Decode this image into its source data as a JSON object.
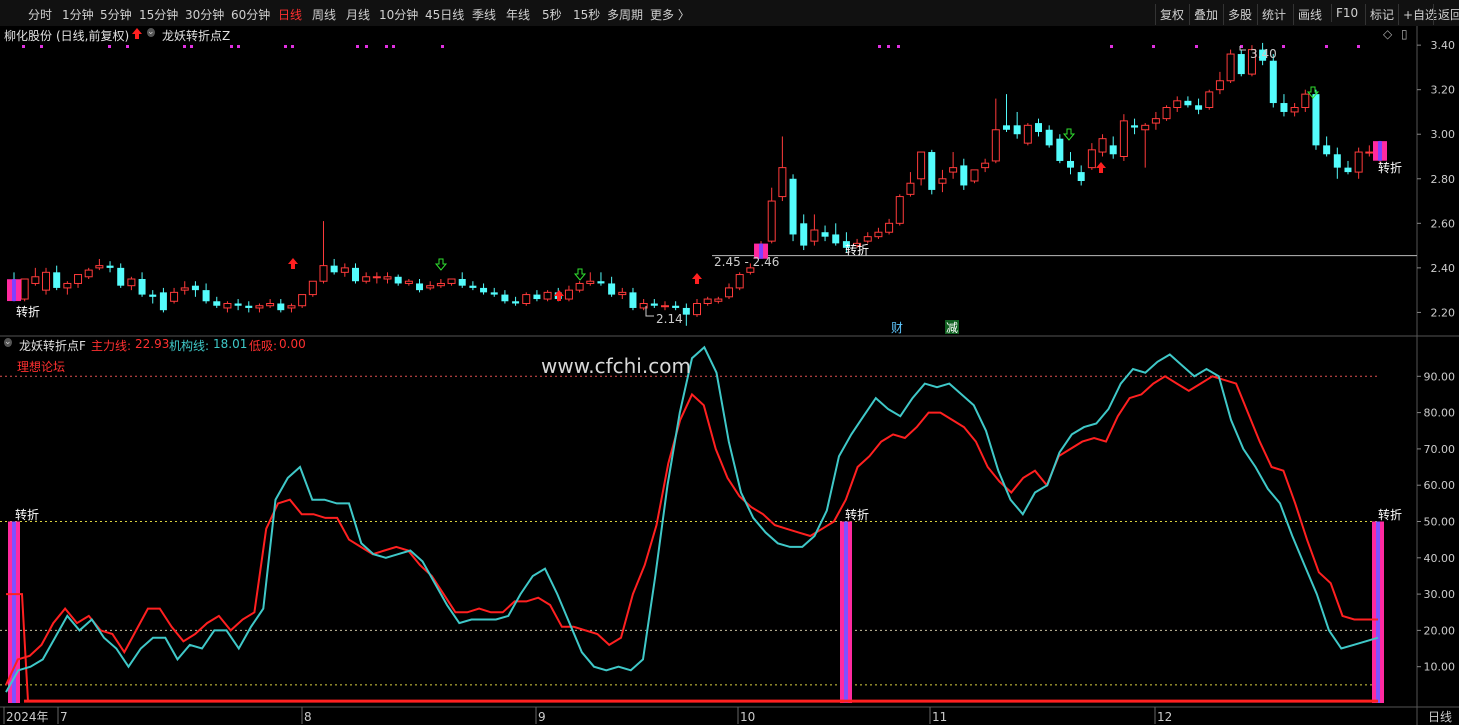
{
  "toolbar": {
    "timeframes": [
      "分时",
      "1分钟",
      "5分钟",
      "15分钟",
      "30分钟",
      "60分钟",
      "日线",
      "周线",
      "月线",
      "10分钟",
      "45日线",
      "季线",
      "年线",
      "5秒",
      "15秒",
      "多周期",
      "更多 〉"
    ],
    "active_timeframe": "日线",
    "buttons": [
      "复权",
      "叠加",
      "多股",
      "统计",
      "画线",
      "F10",
      "标记",
      "+自选",
      "返回"
    ]
  },
  "main_panel": {
    "stock_name": "柳化股份",
    "period_info": "(日线,前复权)",
    "indicator_name": "龙妖转折点Z",
    "price_ticks": [
      "3.40",
      "3.20",
      "3.00",
      "2.80",
      "2.60",
      "2.40",
      "2.20"
    ],
    "annotation_low": "2.14",
    "annotation_range": "2.45 - 2.46",
    "annotation_high": "3.40",
    "turn_label": "转折",
    "event_cai": "财",
    "event_jian": "减"
  },
  "indicator_panel": {
    "name": "龙妖转折点F",
    "main_label": "主力线:",
    "main_value": "22.93",
    "inst_label": "机构线:",
    "inst_value": "18.01",
    "low_label": "低吸:",
    "low_value": "0.00",
    "forum": "理想论坛",
    "watermark": "www.cfchi.com",
    "ticks": [
      "90.00",
      "80.00",
      "70.00",
      "60.00",
      "50.00",
      "40.00",
      "30.00",
      "20.00",
      "10.00"
    ],
    "turn_label": "转折"
  },
  "time_axis": {
    "labels": [
      "2024年",
      "7",
      "8",
      "9",
      "10",
      "11",
      "12"
    ],
    "right_label": "日线"
  },
  "colors": {
    "up": "#ff3b3b",
    "down": "#54fcfc",
    "main_line": "#ff2020",
    "inst_line": "#3fc8c8",
    "turn_bar": "#ff2aa0"
  },
  "chart_data": {
    "type": "candlestick",
    "candles": [
      [
        2.34,
        2.38,
        2.26,
        2.25
      ],
      [
        2.26,
        2.31,
        2.35,
        2.25
      ],
      [
        2.33,
        2.4,
        2.36,
        2.32
      ],
      [
        2.3,
        2.4,
        2.38,
        2.28
      ],
      [
        2.38,
        2.41,
        2.31,
        2.3
      ],
      [
        2.31,
        2.34,
        2.33,
        2.28
      ],
      [
        2.33,
        2.37,
        2.37,
        2.31
      ],
      [
        2.36,
        2.4,
        2.39,
        2.35
      ],
      [
        2.4,
        2.44,
        2.41,
        2.39
      ],
      [
        2.41,
        2.43,
        2.4,
        2.38
      ],
      [
        2.4,
        2.42,
        2.32,
        2.31
      ],
      [
        2.32,
        2.36,
        2.35,
        2.3
      ],
      [
        2.35,
        2.38,
        2.28,
        2.27
      ],
      [
        2.28,
        2.3,
        2.27,
        2.24
      ],
      [
        2.29,
        2.31,
        2.21,
        2.2
      ],
      [
        2.25,
        2.31,
        2.29,
        2.24
      ],
      [
        2.3,
        2.34,
        2.31,
        2.28
      ],
      [
        2.32,
        2.34,
        2.3,
        2.27
      ],
      [
        2.3,
        2.33,
        2.25,
        2.24
      ],
      [
        2.25,
        2.27,
        2.23,
        2.22
      ],
      [
        2.22,
        2.25,
        2.24,
        2.2
      ],
      [
        2.24,
        2.26,
        2.23,
        2.21
      ],
      [
        2.23,
        2.25,
        2.22,
        2.2
      ],
      [
        2.22,
        2.24,
        2.23,
        2.2
      ],
      [
        2.23,
        2.26,
        2.24,
        2.22
      ],
      [
        2.24,
        2.26,
        2.21,
        2.2
      ],
      [
        2.22,
        2.24,
        2.23,
        2.2
      ],
      [
        2.23,
        2.28,
        2.28,
        2.22
      ],
      [
        2.28,
        2.34,
        2.34,
        2.27
      ],
      [
        2.34,
        2.61,
        2.41,
        2.33
      ],
      [
        2.41,
        2.44,
        2.38,
        2.37
      ],
      [
        2.38,
        2.42,
        2.4,
        2.36
      ],
      [
        2.4,
        2.42,
        2.34,
        2.33
      ],
      [
        2.34,
        2.38,
        2.36,
        2.33
      ],
      [
        2.36,
        2.38,
        2.36,
        2.33
      ],
      [
        2.35,
        2.38,
        2.36,
        2.33
      ],
      [
        2.36,
        2.37,
        2.33,
        2.32
      ],
      [
        2.33,
        2.35,
        2.34,
        2.32
      ],
      [
        2.33,
        2.35,
        2.3,
        2.29
      ],
      [
        2.31,
        2.34,
        2.32,
        2.3
      ],
      [
        2.32,
        2.35,
        2.33,
        2.31
      ],
      [
        2.33,
        2.35,
        2.35,
        2.32
      ],
      [
        2.35,
        2.38,
        2.32,
        2.31
      ],
      [
        2.32,
        2.34,
        2.31,
        2.3
      ],
      [
        2.31,
        2.33,
        2.29,
        2.28
      ],
      [
        2.29,
        2.31,
        2.28,
        2.27
      ],
      [
        2.28,
        2.3,
        2.25,
        2.24
      ],
      [
        2.25,
        2.27,
        2.24,
        2.23
      ],
      [
        2.24,
        2.29,
        2.28,
        2.23
      ],
      [
        2.28,
        2.3,
        2.26,
        2.25
      ],
      [
        2.26,
        2.3,
        2.29,
        2.25
      ],
      [
        2.29,
        2.31,
        2.26,
        2.25
      ],
      [
        2.26,
        2.32,
        2.3,
        2.25
      ],
      [
        2.3,
        2.34,
        2.33,
        2.29
      ],
      [
        2.33,
        2.38,
        2.34,
        2.32
      ],
      [
        2.34,
        2.38,
        2.33,
        2.32
      ],
      [
        2.33,
        2.36,
        2.28,
        2.27
      ],
      [
        2.28,
        2.31,
        2.29,
        2.26
      ],
      [
        2.29,
        2.31,
        2.22,
        2.21
      ],
      [
        2.22,
        2.26,
        2.24,
        2.21
      ],
      [
        2.24,
        2.26,
        2.23,
        2.22
      ],
      [
        2.23,
        2.25,
        2.23,
        2.21
      ],
      [
        2.23,
        2.25,
        2.22,
        2.21
      ],
      [
        2.22,
        2.24,
        2.19,
        2.14
      ],
      [
        2.19,
        2.26,
        2.24,
        2.18
      ],
      [
        2.24,
        2.27,
        2.26,
        2.23
      ],
      [
        2.25,
        2.27,
        2.26,
        2.24
      ],
      [
        2.27,
        2.33,
        2.31,
        2.26
      ],
      [
        2.31,
        2.38,
        2.37,
        2.3
      ],
      [
        2.38,
        2.42,
        2.4,
        2.37
      ],
      [
        2.45,
        2.52,
        2.5,
        2.45
      ],
      [
        2.52,
        2.76,
        2.7,
        2.51
      ],
      [
        2.72,
        2.99,
        2.85,
        2.7
      ],
      [
        2.8,
        2.82,
        2.55,
        2.52
      ],
      [
        2.6,
        2.64,
        2.5,
        2.48
      ],
      [
        2.52,
        2.64,
        2.57,
        2.5
      ],
      [
        2.56,
        2.59,
        2.54,
        2.52
      ],
      [
        2.55,
        2.6,
        2.51,
        2.5
      ],
      [
        2.52,
        2.56,
        2.49,
        2.47
      ],
      [
        2.5,
        2.53,
        2.51,
        2.49
      ],
      [
        2.52,
        2.56,
        2.54,
        2.51
      ],
      [
        2.54,
        2.58,
        2.56,
        2.53
      ],
      [
        2.56,
        2.62,
        2.6,
        2.55
      ],
      [
        2.6,
        2.73,
        2.72,
        2.59
      ],
      [
        2.73,
        2.83,
        2.78,
        2.72
      ],
      [
        2.8,
        2.92,
        2.92,
        2.77
      ],
      [
        2.92,
        2.93,
        2.75,
        2.73
      ],
      [
        2.78,
        2.84,
        2.8,
        2.74
      ],
      [
        2.83,
        2.92,
        2.85,
        2.8
      ],
      [
        2.86,
        2.89,
        2.77,
        2.75
      ],
      [
        2.79,
        2.84,
        2.84,
        2.78
      ],
      [
        2.85,
        2.89,
        2.87,
        2.83
      ],
      [
        2.88,
        3.16,
        3.02,
        2.87
      ],
      [
        3.04,
        3.18,
        3.02,
        3.01
      ],
      [
        3.04,
        3.1,
        3.0,
        2.98
      ],
      [
        2.96,
        3.05,
        3.04,
        2.95
      ],
      [
        3.05,
        3.07,
        3.01,
        2.99
      ],
      [
        3.02,
        3.04,
        2.95,
        2.94
      ],
      [
        2.98,
        3.0,
        2.88,
        2.87
      ],
      [
        2.88,
        2.92,
        2.85,
        2.82
      ],
      [
        2.83,
        2.86,
        2.79,
        2.77
      ],
      [
        2.85,
        2.96,
        2.93,
        2.84
      ],
      [
        2.92,
        3.0,
        2.98,
        2.9
      ],
      [
        2.95,
        2.99,
        2.91,
        2.89
      ],
      [
        2.9,
        3.09,
        3.06,
        2.88
      ],
      [
        3.04,
        3.07,
        3.03,
        3.0
      ],
      [
        3.02,
        3.05,
        3.04,
        2.85
      ],
      [
        3.05,
        3.1,
        3.07,
        3.02
      ],
      [
        3.07,
        3.13,
        3.12,
        3.06
      ],
      [
        3.12,
        3.17,
        3.15,
        3.1
      ],
      [
        3.15,
        3.17,
        3.13,
        3.12
      ],
      [
        3.13,
        3.16,
        3.11,
        3.09
      ],
      [
        3.12,
        3.2,
        3.19,
        3.11
      ],
      [
        3.2,
        3.28,
        3.24,
        3.18
      ],
      [
        3.24,
        3.38,
        3.36,
        3.23
      ],
      [
        3.36,
        3.38,
        3.27,
        3.26
      ],
      [
        3.27,
        3.4,
        3.38,
        3.26
      ],
      [
        3.38,
        3.41,
        3.33,
        3.31
      ],
      [
        3.33,
        3.36,
        3.14,
        3.12
      ],
      [
        3.14,
        3.18,
        3.1,
        3.08
      ],
      [
        3.1,
        3.14,
        3.12,
        3.08
      ],
      [
        3.12,
        3.2,
        3.18,
        3.1
      ],
      [
        3.18,
        3.2,
        2.95,
        2.93
      ],
      [
        2.95,
        2.99,
        2.91,
        2.9
      ],
      [
        2.91,
        2.94,
        2.85,
        2.8
      ],
      [
        2.85,
        2.88,
        2.83,
        2.82
      ],
      [
        2.83,
        2.94,
        2.92,
        2.8
      ],
      [
        2.92,
        2.95,
        2.92,
        2.9
      ],
      [
        2.89,
        2.97,
        2.96,
        2.87
      ]
    ],
    "indicator_series": [
      {
        "name": "主力线",
        "values": [
          5,
          12,
          13,
          16,
          22,
          26,
          22,
          24,
          20,
          19,
          14,
          20,
          26,
          26,
          21,
          17,
          19,
          22,
          24,
          20,
          23,
          25,
          48,
          55,
          56,
          52,
          52,
          51,
          51,
          45,
          43,
          41,
          42,
          43,
          42,
          38,
          35,
          30,
          25,
          25,
          26,
          25,
          25,
          28,
          28,
          29,
          27,
          21,
          21,
          20,
          19,
          16,
          18,
          30,
          38,
          49,
          66,
          78,
          85,
          82,
          70,
          62,
          57,
          54,
          52,
          49,
          48,
          47,
          46,
          48,
          50,
          56,
          65,
          68,
          72,
          74,
          73,
          76,
          80,
          80,
          78,
          76,
          72,
          65,
          61,
          58,
          62,
          64,
          60,
          68,
          70,
          72,
          73,
          72,
          79,
          84,
          85,
          88,
          90,
          88,
          86,
          88,
          90,
          89,
          88,
          80,
          72,
          65,
          64,
          55,
          45,
          36,
          33,
          24,
          23,
          23,
          23
        ]
      },
      {
        "name": "机构线",
        "values": [
          3,
          9,
          10,
          12,
          18,
          24,
          20,
          23,
          18,
          15,
          10,
          15,
          18,
          18,
          12,
          16,
          15,
          20,
          20,
          15,
          21,
          26,
          56,
          62,
          65,
          56,
          56,
          55,
          55,
          44,
          41,
          40,
          41,
          42,
          39,
          33,
          27,
          22,
          23,
          23,
          23,
          24,
          30,
          35,
          37,
          30,
          22,
          14,
          10,
          9,
          10,
          9,
          12,
          35,
          60,
          80,
          95,
          98,
          91,
          72,
          58,
          51,
          47,
          44,
          43,
          43,
          46,
          53,
          68,
          74,
          79,
          84,
          81,
          79,
          84,
          88,
          87,
          88,
          85,
          82,
          75,
          64,
          56,
          52,
          58,
          60,
          69,
          74,
          76,
          77,
          81,
          88,
          92,
          91,
          94,
          96,
          93,
          90,
          92,
          90,
          78,
          70,
          65,
          59,
          55,
          46,
          38,
          30,
          20,
          15,
          16,
          17,
          18
        ]
      }
    ],
    "price_ylim": [
      2.13,
      3.45
    ],
    "indicator_ylim": [
      0,
      100
    ],
    "reference_lines": [
      90,
      50,
      20,
      5
    ]
  }
}
